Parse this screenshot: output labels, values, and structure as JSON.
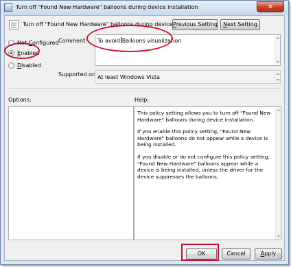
{
  "window": {
    "title": "Turn off \"Found New Hardware\" balloons during device installation",
    "close_glyph": "✕"
  },
  "header": {
    "setting_name": "Turn off \"Found New Hardware\" balloons during device installation",
    "previous_setting": {
      "pre": "",
      "u": "P",
      "post": "revious Setting"
    },
    "next_setting": {
      "pre": "",
      "u": "N",
      "post": "ext Setting"
    }
  },
  "state": {
    "options": [
      {
        "pre": "Not ",
        "u": "C",
        "post": "onfigured",
        "checked": false
      },
      {
        "pre": "",
        "u": "E",
        "post": "nabled",
        "checked": true
      },
      {
        "pre": "",
        "u": "D",
        "post": "isabled",
        "checked": false
      }
    ]
  },
  "comment": {
    "label": "Comment:",
    "before_caret": "To avoid",
    "after_caret": "Balloons visualization"
  },
  "supported": {
    "label": "Supported on:",
    "value": "At least Windows Vista"
  },
  "options_panel": {
    "label": "Options:"
  },
  "help_panel": {
    "label": "Help:",
    "paragraphs": [
      "This policy setting allows you to turn off \"Found New Hardware\" balloons during device installation.",
      "If you enable this policy setting, \"Found New Hardware\" balloons do not appear while a device is being installed.",
      "If you disable or do not configure this policy setting, \"Found New Hardware\" balloons appear while a device is being installed, unless the driver for the device suppresses the balloons."
    ]
  },
  "footer": {
    "ok": "OK",
    "cancel": "Cancel",
    "apply": {
      "pre": "",
      "u": "A",
      "post": "pply"
    }
  },
  "colors": {
    "highlight": "#c8102e",
    "title_bar": "#c9d9ec",
    "dialog_bg": "#f0f0f0"
  }
}
